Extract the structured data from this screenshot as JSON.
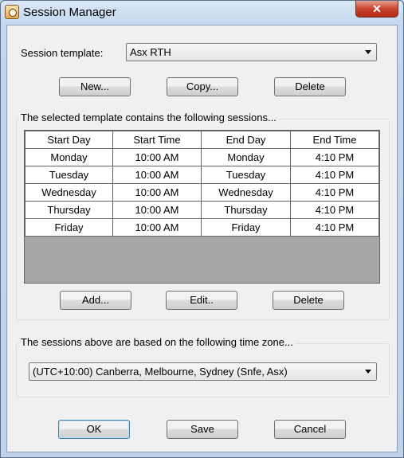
{
  "window": {
    "title": "Session Manager",
    "close_glyph": "✕"
  },
  "template": {
    "label": "Session template:",
    "selected": "Asx RTH",
    "buttons": {
      "new": "New...",
      "copy": "Copy...",
      "delete": "Delete"
    }
  },
  "sessions": {
    "group_title": "The selected template contains the following sessions...",
    "columns": [
      "Start Day",
      "Start Time",
      "End Day",
      "End Time"
    ],
    "rows": [
      [
        "Monday",
        "10:00 AM",
        "Monday",
        "4:10 PM"
      ],
      [
        "Tuesday",
        "10:00 AM",
        "Tuesday",
        "4:10 PM"
      ],
      [
        "Wednesday",
        "10:00 AM",
        "Wednesday",
        "4:10 PM"
      ],
      [
        "Thursday",
        "10:00 AM",
        "Thursday",
        "4:10 PM"
      ],
      [
        "Friday",
        "10:00 AM",
        "Friday",
        "4:10 PM"
      ]
    ],
    "buttons": {
      "add": "Add...",
      "edit": "Edit..",
      "delete": "Delete"
    }
  },
  "timezone": {
    "group_title": "The sessions above are based on the following time zone...",
    "selected": "(UTC+10:00) Canberra, Melbourne, Sydney (Snfe, Asx)"
  },
  "footer": {
    "ok": "OK",
    "save": "Save",
    "cancel": "Cancel"
  },
  "icons": {
    "app": "session-manager-app-icon",
    "close": "close-icon",
    "dropdown": "chevron-down-icon"
  },
  "colors": {
    "close_button": "#c8452d",
    "grid_background": "#a7a7a7",
    "dialog_face": "#f0f0f0"
  }
}
